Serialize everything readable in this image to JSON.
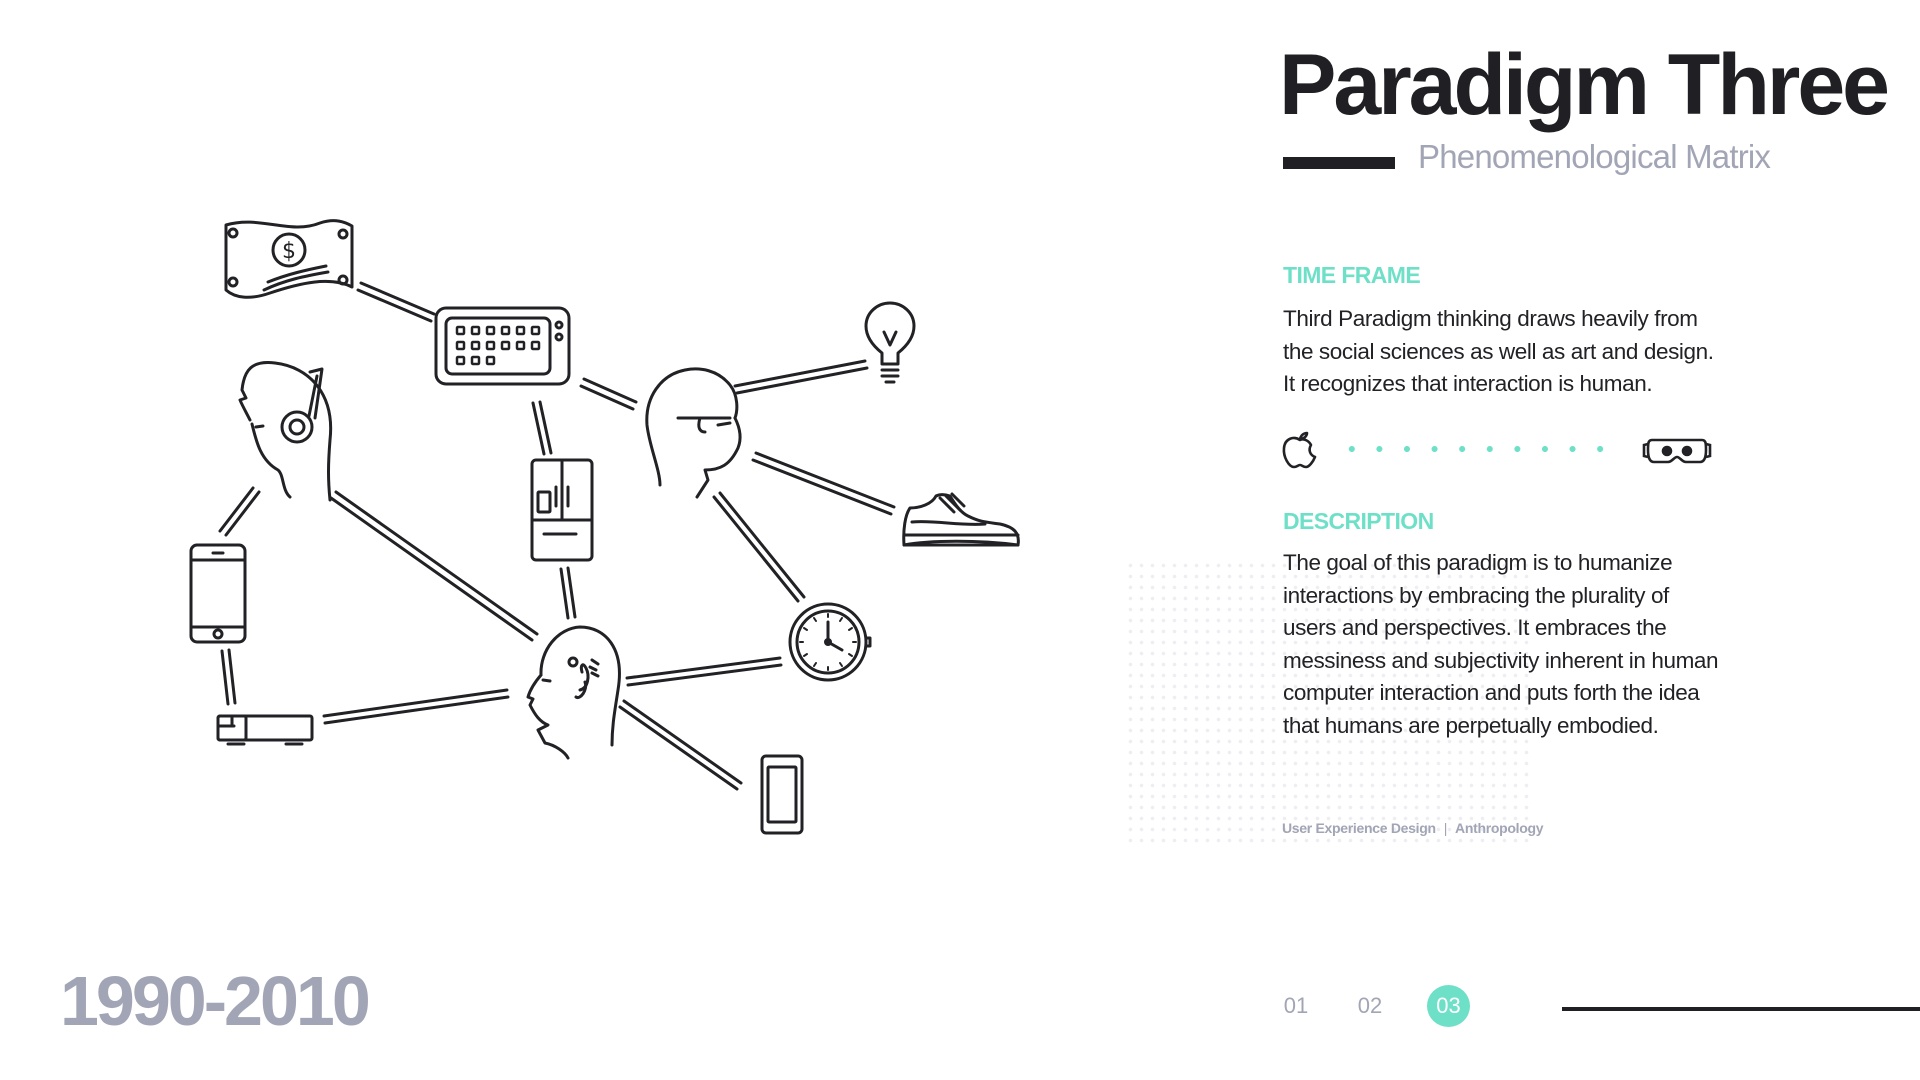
{
  "header": {
    "title": "Paradigm Three",
    "subtitle": "Phenomenological Matrix"
  },
  "time_frame": {
    "label": "TIME FRAME",
    "lines": [
      "Third Paradigm thinking draws heavily from",
      "the social sciences as well as art and design.",
      "It recognizes that interaction is human."
    ],
    "timeline": {
      "start_icon": "apple-logo-icon",
      "end_icon": "vr-headset-icon",
      "accent": "#6fe0c8"
    }
  },
  "description": {
    "label": "DESCRIPTION",
    "lines": [
      "The goal of this paradigm is to humanize",
      "interactions by embracing the plurality of",
      "users and perspectives. It embraces the",
      "messiness and subjectivity inherent in human",
      "computer interaction and puts forth the idea",
      "that humans are perpetually embodied."
    ]
  },
  "tags": {
    "first": "User Experience Design",
    "separator": "|",
    "second": "Anthropology"
  },
  "year_range": "1990-2010",
  "pagination": {
    "pages": [
      "01",
      "02",
      "03"
    ],
    "active": "03"
  },
  "illustration_icons": [
    "money-bill-icon",
    "keyboard-icon",
    "lightbulb-icon",
    "head-headphones-icon",
    "head-glasses-icon",
    "refrigerator-icon",
    "sneaker-icon",
    "smartphone-icon",
    "clock-icon",
    "projector-icon",
    "head-thinking-icon",
    "tablet-icon"
  ],
  "colors": {
    "accent": "#6fe0c8",
    "muted": "#a2a5b5",
    "ink": "#202024"
  }
}
